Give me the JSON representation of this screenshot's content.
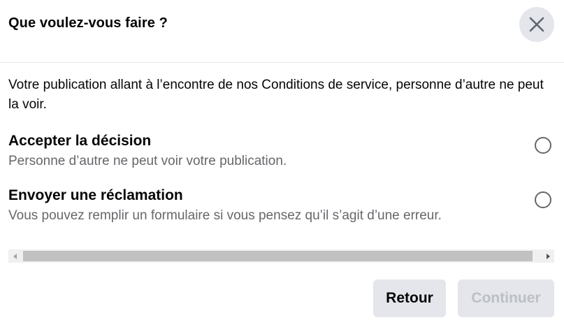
{
  "dialog": {
    "title": "Que voulez-vous faire ?",
    "close_icon": "close-icon",
    "message": "Votre publication allant à l’encontre de nos Conditions de service, personne d’autre ne peut la voir."
  },
  "options": [
    {
      "title": "Accepter la décision",
      "description": "Personne d’autre ne peut voir votre publication.",
      "selected": false
    },
    {
      "title": "Envoyer une réclamation",
      "description": "Vous pouvez remplir un formulaire si vous pensez qu’il s’agit d’une erreur.",
      "selected": false
    }
  ],
  "buttons": {
    "back_label": "Retour",
    "continue_label": "Continuer",
    "continue_disabled": true
  },
  "colors": {
    "text_primary": "#050505",
    "text_secondary": "#65676b",
    "button_bg": "#e4e6eb",
    "disabled_text": "#bcc0c4"
  }
}
